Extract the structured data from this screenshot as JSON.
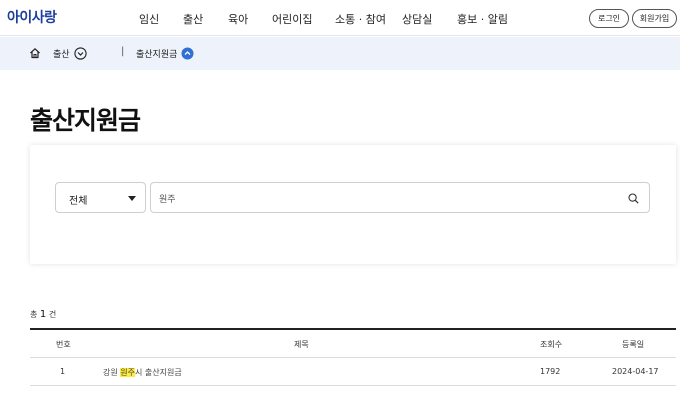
{
  "header": {
    "logo": "아이사랑",
    "nav": [
      "임신",
      "출산",
      "육아",
      "어린이집",
      "소통 · 참여",
      "상담실",
      "홍보 · 알림"
    ],
    "login_label": "로그인",
    "join_label": "회원가입"
  },
  "breadcrumb": {
    "level1": "출산",
    "separator": "|",
    "level2": "출산지원금"
  },
  "page": {
    "title": "출산지원금"
  },
  "search": {
    "category_selected": "전체",
    "query": "원주"
  },
  "results": {
    "total_prefix": "총",
    "total_count": "1",
    "total_suffix": "건",
    "columns": {
      "no": "번호",
      "title": "제목",
      "views": "조회수",
      "date": "등록일"
    },
    "rows": [
      {
        "no": "1",
        "title_before": "강원 ",
        "title_highlight": "원주",
        "title_after": "시 출산지원금",
        "views": "1792",
        "date": "2024-04-17"
      }
    ]
  },
  "colors": {
    "brand": "#1d3f9a",
    "breadcrumb_bg": "#eef3fb",
    "accent_circle": "#2f6fd6",
    "highlight": "#ffec3d"
  },
  "icons": [
    "home-icon",
    "chevron-down-circle-icon",
    "chevron-up-circle-icon",
    "dropdown-caret-icon",
    "search-icon"
  ]
}
